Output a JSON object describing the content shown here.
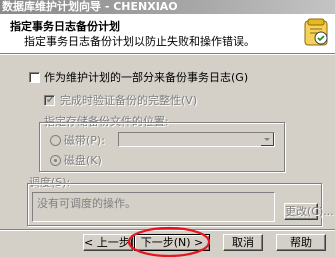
{
  "window": {
    "title": "数据库维护计划向导 - CHENXIAO"
  },
  "header": {
    "title": "指定事务日志备份计划",
    "subtitle": "指定事务日志备份计划以防止失败和操作错误。",
    "icon": "wizard-icon"
  },
  "options": {
    "backup_log_label": "作为维护计划的一部分来备份事务日志(G)",
    "backup_log_checked": false,
    "verify_label": "完成时验证备份的完整性(V)",
    "verify_checked": true,
    "location_label": "指定存储备份文件的位置:",
    "tape_label": "磁带(P):",
    "disk_label": "磁盘(K)",
    "tape_selected": false,
    "disk_selected": true,
    "tape_combo_value": ""
  },
  "schedule": {
    "label": "调度(S):",
    "value": "没有可调度的操作。",
    "change_label": "更改(C)..."
  },
  "footer": {
    "back_label": "< 上一步(B)",
    "next_label": "下一步(N) >",
    "cancel_label": "取消",
    "help_label": "帮助"
  },
  "colors": {
    "annotation": "#e8141e",
    "face": "#d4d0c8",
    "header_bg": "#ffffff"
  }
}
